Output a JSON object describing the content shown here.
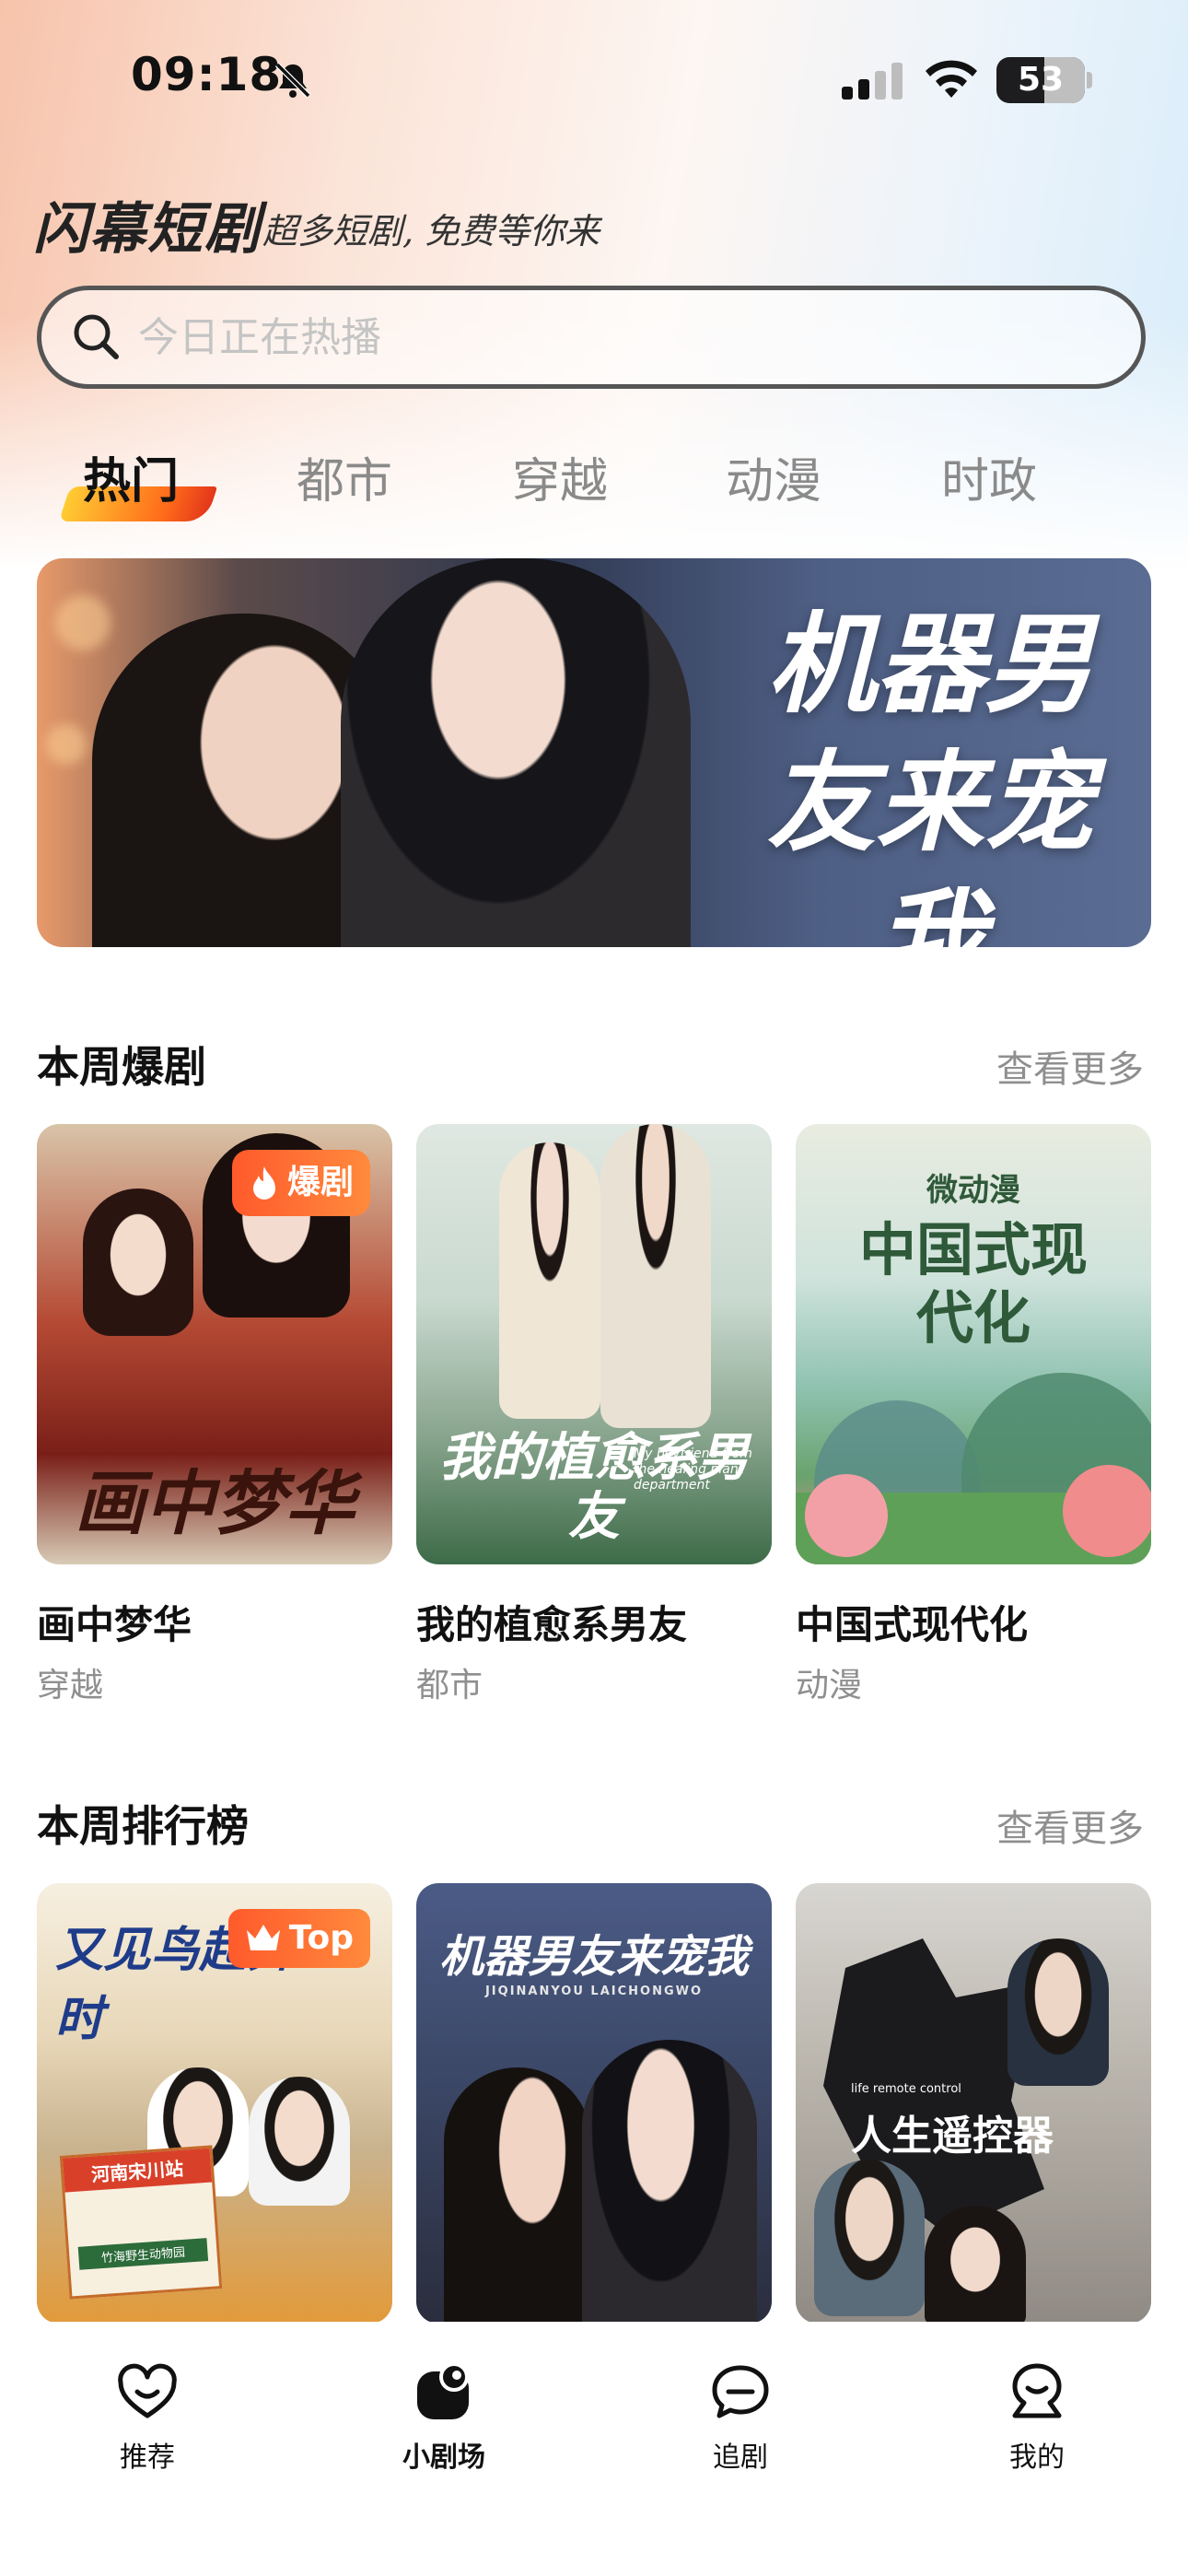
{
  "status_bar": {
    "time": "09:18",
    "battery": "53"
  },
  "header": {
    "app_name": "闪幕短剧",
    "slogan": "超多短剧, 免费等你来"
  },
  "search": {
    "placeholder": "今日正在热播"
  },
  "tabs": [
    {
      "label": "热门",
      "active": true
    },
    {
      "label": "都市",
      "active": false
    },
    {
      "label": "穿越",
      "active": false
    },
    {
      "label": "动漫",
      "active": false
    },
    {
      "label": "时政",
      "active": false
    }
  ],
  "banner": {
    "title": "机器男友来宠我"
  },
  "weekly_hits": {
    "title": "本周爆剧",
    "more": "查看更多",
    "items": [
      {
        "title": "画中梦华",
        "tag": "穿越",
        "badge": "爆剧",
        "poster_text": "画中梦华"
      },
      {
        "title": "我的植愈系男友",
        "tag": "都市",
        "poster_text": "我的植愈系男友",
        "poster_sub": "My boyfriend from the healing plant department"
      },
      {
        "title": "中国式现代化",
        "tag": "动漫",
        "poster_kicker": "微动漫",
        "poster_text": "中国式现代化"
      }
    ]
  },
  "weekly_ranking": {
    "title": "本周排行榜",
    "more": "查看更多",
    "items": [
      {
        "badge": "Top",
        "poster_text": "又见鸟起舞时",
        "station_sign": "河南宋川站",
        "zoo_sign": "竹海野生动物园"
      },
      {
        "poster_text": "机器男友来宠我",
        "poster_sub": "JIQINANYOU LAICHONGWO"
      },
      {
        "poster_text": "人生遥控器",
        "poster_sub": "life remote control"
      }
    ]
  },
  "bottom_nav": [
    {
      "label": "推荐",
      "icon": "heart-smile-icon",
      "active": false
    },
    {
      "label": "小剧场",
      "icon": "theater-icon",
      "active": true
    },
    {
      "label": "追剧",
      "icon": "chat-bubble-icon",
      "active": false
    },
    {
      "label": "我的",
      "icon": "profile-icon",
      "active": false
    }
  ]
}
